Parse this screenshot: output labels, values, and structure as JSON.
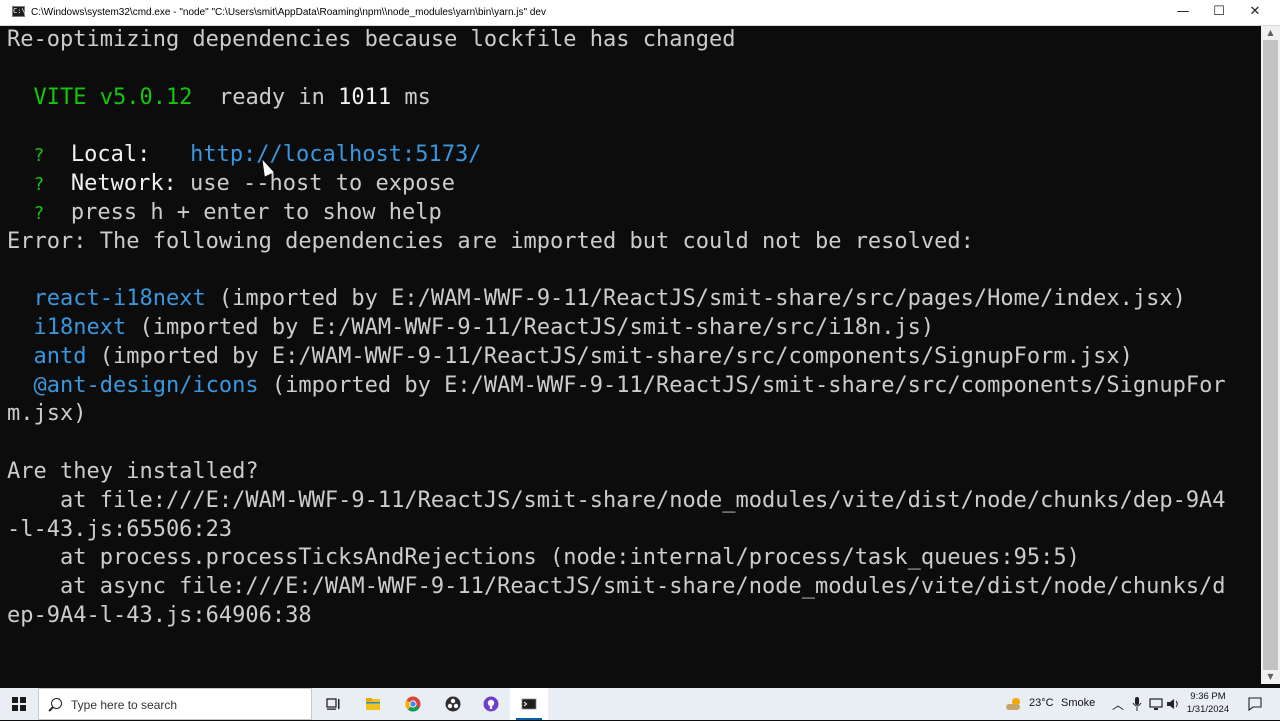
{
  "window": {
    "title": "C:\\Windows\\system32\\cmd.exe - \"node\"  \"C:\\Users\\smit\\AppData\\Roaming\\npm\\\\node_modules\\yarn\\bin\\yarn.js\" dev",
    "app_icon_text": "C:\\",
    "minimize_glyph": "—",
    "maximize_glyph": "☐",
    "close_glyph": "✕"
  },
  "console": {
    "l1": "Re-optimizing dependencies because lockfile has changed",
    "vite_name": "VITE v5.0.12",
    "ready_text": "ready in ",
    "ready_ms": "1011",
    "ready_unit": " ms",
    "bullet": "?",
    "local_label": "Local:",
    "local_url": "http://localhost:5173/",
    "network_label": "Network:",
    "network_text": " use --host to expose",
    "help_text": "press h + enter to show help",
    "error_line": "Error: The following dependencies are imported but could not be resolved:",
    "dep1_name": "react-i18next",
    "dep1_path": " (imported by E:/WAM-WWF-9-11/ReactJS/smit-share/src/pages/Home/index.jsx)",
    "dep2_name": "i18next",
    "dep2_path": " (imported by E:/WAM-WWF-9-11/ReactJS/smit-share/src/i18n.js)",
    "dep3_name": "antd",
    "dep3_path": " (imported by E:/WAM-WWF-9-11/ReactJS/smit-share/src/components/SignupForm.jsx)",
    "dep4_name": "@ant-design/icons",
    "dep4_path": " (imported by E:/WAM-WWF-9-11/ReactJS/smit-share/src/components/SignupFor",
    "dep4_cont": "m.jsx)",
    "question": "Are they installed?",
    "st1": "    at file:///E:/WAM-WWF-9-11/ReactJS/smit-share/node_modules/vite/dist/node/chunks/dep-9A4",
    "st1_cont": "-l-43.js:65506:23",
    "st2": "    at process.processTicksAndRejections (node:internal/process/task_queues:95:5)",
    "st3": "    at async file:///E:/WAM-WWF-9-11/ReactJS/smit-share/node_modules/vite/dist/node/chunks/d",
    "st3_cont": "ep-9A4-l-43.js:64906:38"
  },
  "taskbar": {
    "search_placeholder": "Type here to search",
    "apps": [
      "start-icon",
      "task-view-icon",
      "file-explorer-icon",
      "chrome-icon",
      "obs-icon",
      "github-desktop-icon",
      "terminal-icon"
    ],
    "weather_temp": "23°C",
    "weather_text": "Smoke",
    "time": "9:36 PM",
    "date": "1/31/2024"
  },
  "colors": {
    "console_bg": "#0c0c0c",
    "console_fg": "#cccccc",
    "green": "#16c60c",
    "cyan": "#3a96dd"
  }
}
